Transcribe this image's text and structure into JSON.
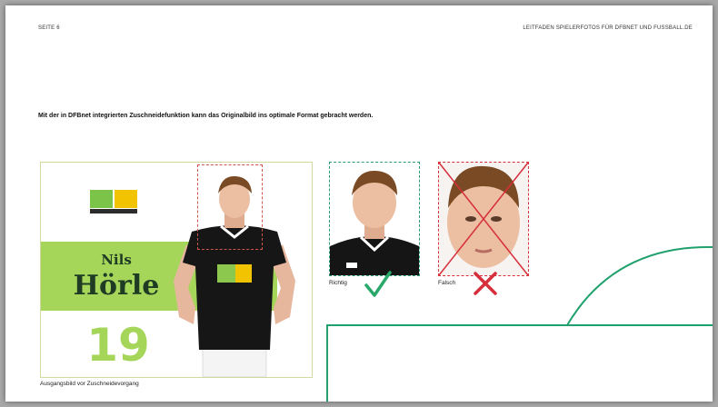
{
  "header": {
    "page_label": "SEITE 6",
    "doc_title": "LEITFADEN SPIELERFOTOS FÜR DFBNET UND FUSSBALL.DE"
  },
  "intro_text": "Mit der in DFBnet integrierten Zuschneidefunktion kann das Originalbild ins optimale Format gebracht werden.",
  "card": {
    "first_name": "Nils",
    "last_name": "Hörle",
    "number": "19",
    "band_color": "#a5d65a",
    "text_color": "#1f3b24"
  },
  "captions": {
    "original": "Ausgangsbild vor Zuschneidevorgang",
    "correct": "Richtig",
    "wrong": "Falsch"
  },
  "colors": {
    "correct": "#2aa86c",
    "wrong": "#d62e3a",
    "frame_line": "#1fa06c"
  },
  "icons": {
    "correct": "checkmark-icon",
    "wrong": "x-cross-icon"
  }
}
